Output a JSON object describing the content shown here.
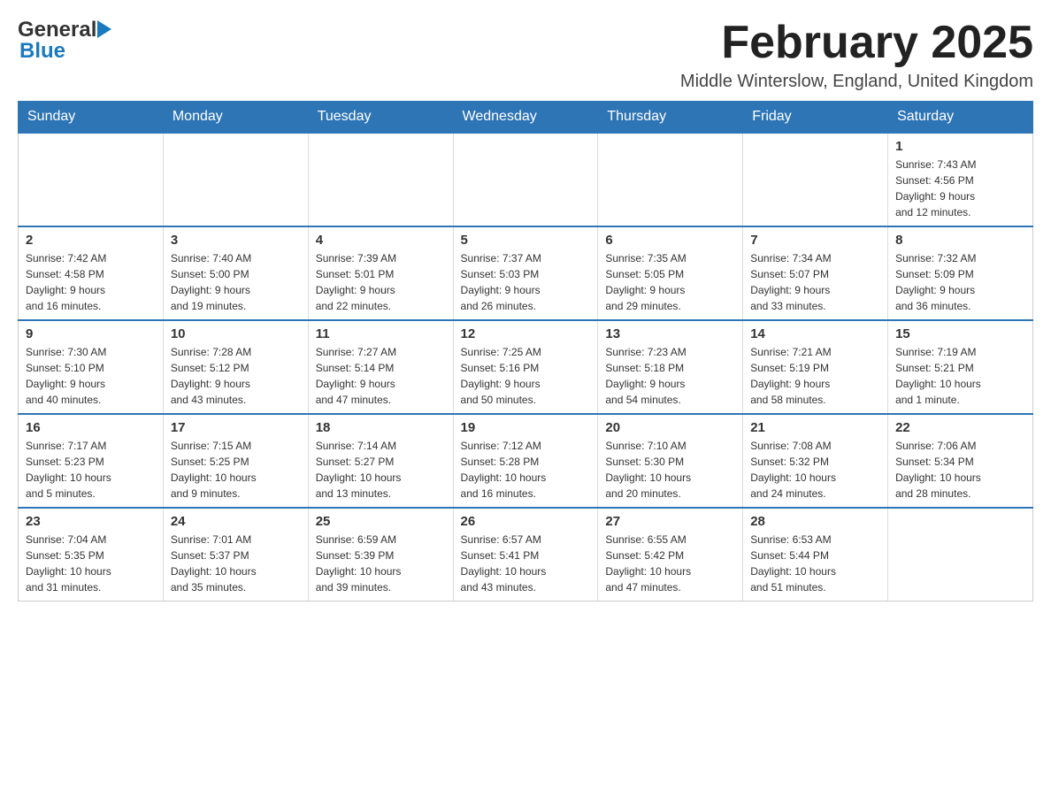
{
  "header": {
    "logo_general": "General",
    "logo_blue": "Blue",
    "month_title": "February 2025",
    "subtitle": "Middle Winterslow, England, United Kingdom"
  },
  "days_of_week": [
    "Sunday",
    "Monday",
    "Tuesday",
    "Wednesday",
    "Thursday",
    "Friday",
    "Saturday"
  ],
  "weeks": [
    {
      "days": [
        {
          "number": "",
          "info": "",
          "empty": true
        },
        {
          "number": "",
          "info": "",
          "empty": true
        },
        {
          "number": "",
          "info": "",
          "empty": true
        },
        {
          "number": "",
          "info": "",
          "empty": true
        },
        {
          "number": "",
          "info": "",
          "empty": true
        },
        {
          "number": "",
          "info": "",
          "empty": true
        },
        {
          "number": "1",
          "info": "Sunrise: 7:43 AM\nSunset: 4:56 PM\nDaylight: 9 hours\nand 12 minutes.",
          "empty": false
        }
      ]
    },
    {
      "days": [
        {
          "number": "2",
          "info": "Sunrise: 7:42 AM\nSunset: 4:58 PM\nDaylight: 9 hours\nand 16 minutes.",
          "empty": false
        },
        {
          "number": "3",
          "info": "Sunrise: 7:40 AM\nSunset: 5:00 PM\nDaylight: 9 hours\nand 19 minutes.",
          "empty": false
        },
        {
          "number": "4",
          "info": "Sunrise: 7:39 AM\nSunset: 5:01 PM\nDaylight: 9 hours\nand 22 minutes.",
          "empty": false
        },
        {
          "number": "5",
          "info": "Sunrise: 7:37 AM\nSunset: 5:03 PM\nDaylight: 9 hours\nand 26 minutes.",
          "empty": false
        },
        {
          "number": "6",
          "info": "Sunrise: 7:35 AM\nSunset: 5:05 PM\nDaylight: 9 hours\nand 29 minutes.",
          "empty": false
        },
        {
          "number": "7",
          "info": "Sunrise: 7:34 AM\nSunset: 5:07 PM\nDaylight: 9 hours\nand 33 minutes.",
          "empty": false
        },
        {
          "number": "8",
          "info": "Sunrise: 7:32 AM\nSunset: 5:09 PM\nDaylight: 9 hours\nand 36 minutes.",
          "empty": false
        }
      ]
    },
    {
      "days": [
        {
          "number": "9",
          "info": "Sunrise: 7:30 AM\nSunset: 5:10 PM\nDaylight: 9 hours\nand 40 minutes.",
          "empty": false
        },
        {
          "number": "10",
          "info": "Sunrise: 7:28 AM\nSunset: 5:12 PM\nDaylight: 9 hours\nand 43 minutes.",
          "empty": false
        },
        {
          "number": "11",
          "info": "Sunrise: 7:27 AM\nSunset: 5:14 PM\nDaylight: 9 hours\nand 47 minutes.",
          "empty": false
        },
        {
          "number": "12",
          "info": "Sunrise: 7:25 AM\nSunset: 5:16 PM\nDaylight: 9 hours\nand 50 minutes.",
          "empty": false
        },
        {
          "number": "13",
          "info": "Sunrise: 7:23 AM\nSunset: 5:18 PM\nDaylight: 9 hours\nand 54 minutes.",
          "empty": false
        },
        {
          "number": "14",
          "info": "Sunrise: 7:21 AM\nSunset: 5:19 PM\nDaylight: 9 hours\nand 58 minutes.",
          "empty": false
        },
        {
          "number": "15",
          "info": "Sunrise: 7:19 AM\nSunset: 5:21 PM\nDaylight: 10 hours\nand 1 minute.",
          "empty": false
        }
      ]
    },
    {
      "days": [
        {
          "number": "16",
          "info": "Sunrise: 7:17 AM\nSunset: 5:23 PM\nDaylight: 10 hours\nand 5 minutes.",
          "empty": false
        },
        {
          "number": "17",
          "info": "Sunrise: 7:15 AM\nSunset: 5:25 PM\nDaylight: 10 hours\nand 9 minutes.",
          "empty": false
        },
        {
          "number": "18",
          "info": "Sunrise: 7:14 AM\nSunset: 5:27 PM\nDaylight: 10 hours\nand 13 minutes.",
          "empty": false
        },
        {
          "number": "19",
          "info": "Sunrise: 7:12 AM\nSunset: 5:28 PM\nDaylight: 10 hours\nand 16 minutes.",
          "empty": false
        },
        {
          "number": "20",
          "info": "Sunrise: 7:10 AM\nSunset: 5:30 PM\nDaylight: 10 hours\nand 20 minutes.",
          "empty": false
        },
        {
          "number": "21",
          "info": "Sunrise: 7:08 AM\nSunset: 5:32 PM\nDaylight: 10 hours\nand 24 minutes.",
          "empty": false
        },
        {
          "number": "22",
          "info": "Sunrise: 7:06 AM\nSunset: 5:34 PM\nDaylight: 10 hours\nand 28 minutes.",
          "empty": false
        }
      ]
    },
    {
      "days": [
        {
          "number": "23",
          "info": "Sunrise: 7:04 AM\nSunset: 5:35 PM\nDaylight: 10 hours\nand 31 minutes.",
          "empty": false
        },
        {
          "number": "24",
          "info": "Sunrise: 7:01 AM\nSunset: 5:37 PM\nDaylight: 10 hours\nand 35 minutes.",
          "empty": false
        },
        {
          "number": "25",
          "info": "Sunrise: 6:59 AM\nSunset: 5:39 PM\nDaylight: 10 hours\nand 39 minutes.",
          "empty": false
        },
        {
          "number": "26",
          "info": "Sunrise: 6:57 AM\nSunset: 5:41 PM\nDaylight: 10 hours\nand 43 minutes.",
          "empty": false
        },
        {
          "number": "27",
          "info": "Sunrise: 6:55 AM\nSunset: 5:42 PM\nDaylight: 10 hours\nand 47 minutes.",
          "empty": false
        },
        {
          "number": "28",
          "info": "Sunrise: 6:53 AM\nSunset: 5:44 PM\nDaylight: 10 hours\nand 51 minutes.",
          "empty": false
        },
        {
          "number": "",
          "info": "",
          "empty": true
        }
      ]
    }
  ]
}
